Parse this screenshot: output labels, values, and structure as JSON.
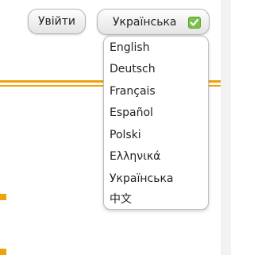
{
  "header": {
    "login_label": "Увійти",
    "language_select": {
      "selected": "Українська",
      "check_color": "#7cc04a",
      "icon": "check-icon"
    }
  },
  "language_menu": {
    "items": [
      "English",
      "Deutsch",
      "Français",
      "Español",
      "Polski",
      "Ελληνικά",
      "Українська",
      "中文"
    ]
  },
  "colors": {
    "accent": "#f0a20a",
    "page_background": "#ffffff",
    "side_panel": "#f2f2f2"
  }
}
